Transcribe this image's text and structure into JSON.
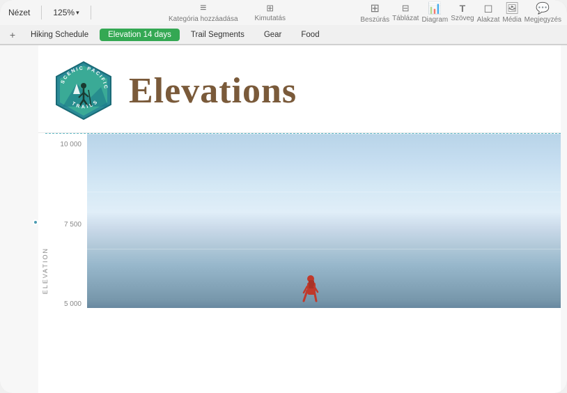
{
  "toolbar": {
    "view_label": "Nézet",
    "zoom_label": "125%",
    "zoom_chevron": "▾",
    "tools": [
      {
        "id": "insert",
        "icon": "⊞",
        "label": "Beszúrás"
      },
      {
        "id": "table",
        "icon": "⊟",
        "label": "Táblázat"
      },
      {
        "id": "chart",
        "icon": "⊙",
        "label": "Diagram"
      },
      {
        "id": "text",
        "icon": "T",
        "label": "Szöveg"
      },
      {
        "id": "shape",
        "icon": "◻",
        "label": "Alakzat"
      },
      {
        "id": "media",
        "icon": "⊡",
        "label": "Média"
      },
      {
        "id": "comment",
        "icon": "💬",
        "label": "Megjegyzés"
      }
    ],
    "center_tools": [
      {
        "id": "category",
        "icon": "≡",
        "label": "Kategória hozzáadása"
      },
      {
        "id": "report",
        "icon": "⊞",
        "label": "Kimutatás"
      }
    ]
  },
  "tabs": [
    {
      "id": "hiking",
      "label": "Hiking Schedule",
      "active": false
    },
    {
      "id": "elevation",
      "label": "Elevation 14 days",
      "active": true
    },
    {
      "id": "trail",
      "label": "Trail Segments",
      "active": false
    },
    {
      "id": "gear",
      "label": "Gear",
      "active": false
    },
    {
      "id": "food",
      "label": "Food",
      "active": false
    }
  ],
  "document": {
    "title": "Elevations",
    "logo_text": "SCENIC PACIFIC TRAILS"
  },
  "chart": {
    "y_axis_label": "ELEVATION",
    "y_ticks": [
      "10 000",
      "7 500",
      "5 000"
    ],
    "grid_lines": [
      0,
      33,
      66
    ]
  }
}
